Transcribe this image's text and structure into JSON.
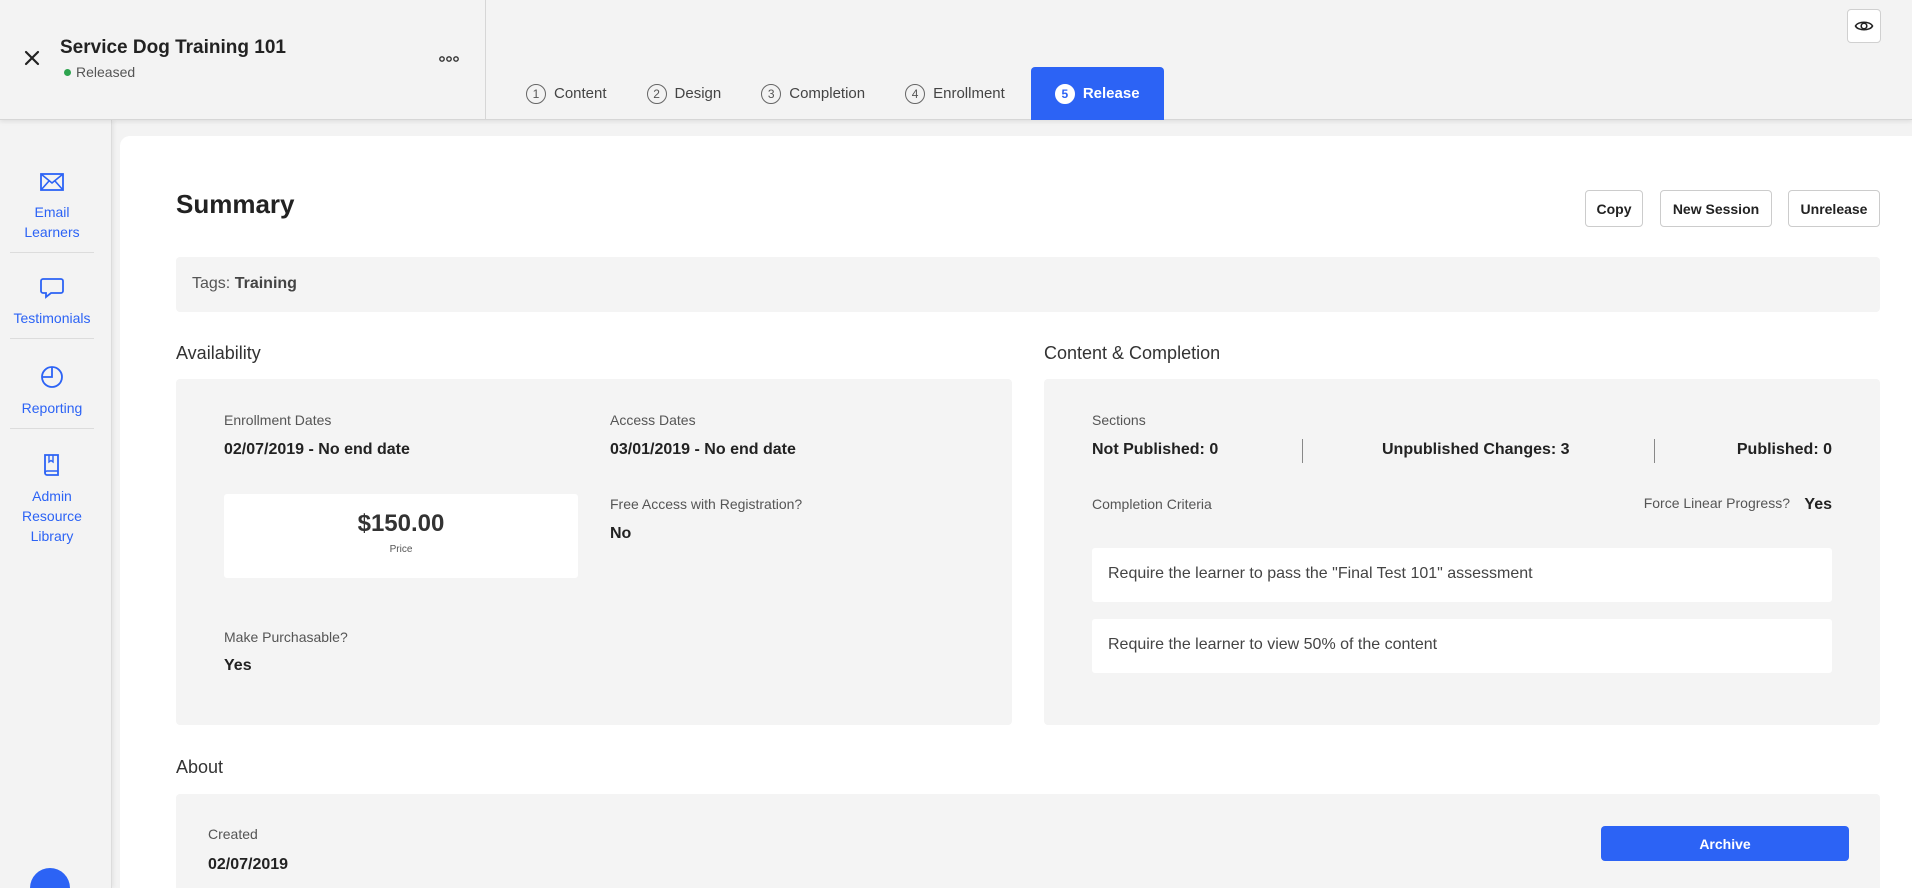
{
  "header": {
    "course_title": "Service Dog Training 101",
    "status": "Released",
    "tabs": [
      {
        "num": "1",
        "label": "Content"
      },
      {
        "num": "2",
        "label": "Design"
      },
      {
        "num": "3",
        "label": "Completion"
      },
      {
        "num": "4",
        "label": "Enrollment"
      },
      {
        "num": "5",
        "label": "Release"
      }
    ],
    "active_tab": "Release"
  },
  "sidebar": {
    "items": [
      {
        "label": "Email Learners",
        "icon": "envelope-icon"
      },
      {
        "label": "Testimonials",
        "icon": "speech-bubble-icon"
      },
      {
        "label": "Reporting",
        "icon": "pie-chart-icon"
      },
      {
        "label": "Admin Resource Library",
        "icon": "book-icon"
      }
    ]
  },
  "summary": {
    "title": "Summary",
    "buttons": {
      "copy": "Copy",
      "new_session": "New Session",
      "unrelease": "Unrelease"
    },
    "tags_label": "Tags:",
    "tags_value": "Training"
  },
  "availability": {
    "title": "Availability",
    "enrollment_dates_label": "Enrollment Dates",
    "enrollment_dates": "02/07/2019 - No end date",
    "access_dates_label": "Access Dates",
    "access_dates": "03/01/2019 - No end date",
    "price": "$150.00",
    "price_label": "Price",
    "free_access_label": "Free Access with Registration?",
    "free_access": "No",
    "purchasable_label": "Make Purchasable?",
    "purchasable": "Yes"
  },
  "content_completion": {
    "title": "Content & Completion",
    "sections_label": "Sections",
    "not_published": "Not Published: 0",
    "unpublished_changes": "Unpublished Changes: 3",
    "published": "Published: 0",
    "criteria_label": "Completion Criteria",
    "force_linear_label": "Force Linear Progress?",
    "force_linear": "Yes",
    "criteria": [
      "Require the learner to pass the \"Final Test 101\" assessment",
      "Require the learner to view 50% of the content"
    ]
  },
  "about": {
    "title": "About",
    "created_label": "Created",
    "created": "02/07/2019",
    "archive_label": "Archive"
  },
  "colors": {
    "accent": "#2c63f5",
    "status_green": "#2ea44f"
  }
}
